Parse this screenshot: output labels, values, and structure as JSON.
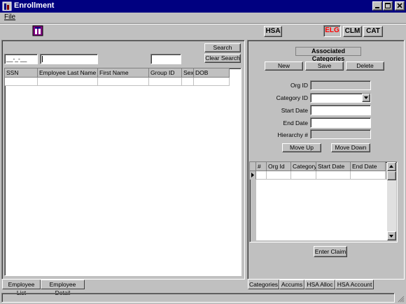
{
  "window": {
    "title": "Enrollment"
  },
  "menu": {
    "file_label": "File"
  },
  "toolbar": {
    "hsa_label": "HSA",
    "elg_label": "ELG",
    "clm_label": "CLM",
    "cat_label": "CAT"
  },
  "search": {
    "ssn_value": "__-_-__",
    "search_label": "Search",
    "clear_label": "Clear Search"
  },
  "employee_grid": {
    "columns": [
      "SSN",
      "Employee Last Name",
      "First Name",
      "Group ID",
      "Sex",
      "DOB"
    ]
  },
  "left_tabs": [
    "Employee List",
    "Employee Detail"
  ],
  "categories_panel": {
    "heading": "Associated Categories",
    "new_label": "New",
    "save_label": "Save",
    "delete_label": "Delete",
    "org_id_label": "Org ID",
    "category_id_label": "Category ID",
    "start_date_label": "Start Date",
    "end_date_label": "End Date",
    "hierarchy_label": "Hierarchy #",
    "move_up_label": "Move Up",
    "move_down_label": "Move Down",
    "enter_claim_label": "Enter Claim"
  },
  "category_grid": {
    "columns": [
      "#",
      "Org Id",
      "Category",
      "Start Date",
      "End Date"
    ]
  },
  "right_tabs": [
    "Categories",
    "Accums",
    "HSA Alloc",
    "HSA Account"
  ],
  "colors": {
    "titlebar": "#000080",
    "elg_text": "#ff0000",
    "face": "#c0c0c0"
  }
}
